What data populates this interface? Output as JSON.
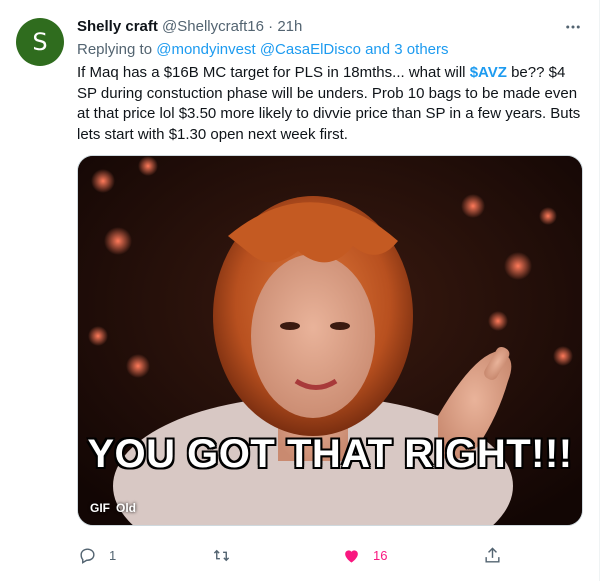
{
  "tweet": {
    "avatar_letter": "S",
    "avatar_color": "#2f6c1e",
    "display_name": "Shelly craft",
    "handle": "@Shellycraft16",
    "separator": "·",
    "time": "21h",
    "more_icon": "more-horizontal-icon",
    "replying_prefix": "Replying to",
    "reply_to_1": "@mondyinvest",
    "reply_to_2": "@CasaElDisco",
    "reply_and": "and",
    "reply_others": "3 others",
    "text_part_1": "If Maq has a $16B MC target for PLS in 18mths... what will",
    "cashtag": "$AVZ",
    "text_part_2": "be?? $4 SP during constuction phase will be unders. Prob 10 bags to be made even at that price lol $3.50 more likely to divvie price than SP in a few years. Buts lets start with $1.30 open next week first."
  },
  "media": {
    "caption": "YOU GOT THAT RIGHT!!!",
    "gif_badge": "GIF",
    "alt_badge": "Old"
  },
  "actions": {
    "reply_icon": "reply-icon",
    "reply_count": "1",
    "retweet_icon": "retweet-icon",
    "like_icon": "heart-filled-icon",
    "like_count": "16",
    "like_color": "#f91880",
    "share_icon": "share-icon"
  },
  "colors": {
    "link": "#1d9bf0",
    "muted": "#536471",
    "text": "#0f1419"
  }
}
